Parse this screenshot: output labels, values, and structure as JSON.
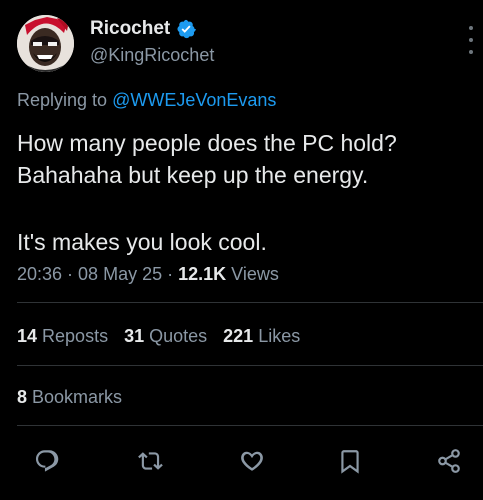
{
  "author": {
    "display_name": "Ricochet",
    "handle": "@KingRicochet",
    "avatar_icon": "avatar-illustration",
    "verified_icon": "verified-badge-icon"
  },
  "reply": {
    "prefix": "Replying to ",
    "handle": "@WWEJeVonEvans"
  },
  "tweet": {
    "line1": "How many people does the PC hold?",
    "line2": "Bahahaha but keep up the energy.",
    "line3": "It's makes you look cool."
  },
  "meta": {
    "time": "20:36",
    "sep1": " · ",
    "date": "08 May 25",
    "sep2": " · ",
    "views_count": "12.1K",
    "views_label": " Views"
  },
  "stats": {
    "reposts_count": "14",
    "reposts_label": " Reposts",
    "quotes_count": "31",
    "quotes_label": " Quotes",
    "likes_count": "221",
    "likes_label": " Likes"
  },
  "bookmarks": {
    "count": "8",
    "label": " Bookmarks"
  },
  "actions": [
    {
      "name": "reply-icon"
    },
    {
      "name": "repost-icon"
    },
    {
      "name": "like-icon"
    },
    {
      "name": "bookmark-icon"
    },
    {
      "name": "share-icon"
    }
  ],
  "colors": {
    "background": "#000000",
    "text_primary": "#e7e9ea",
    "text_secondary": "#8b98a5",
    "link": "#1d9bf0",
    "divider": "#2f3336",
    "verified": "#1d9bf0"
  }
}
